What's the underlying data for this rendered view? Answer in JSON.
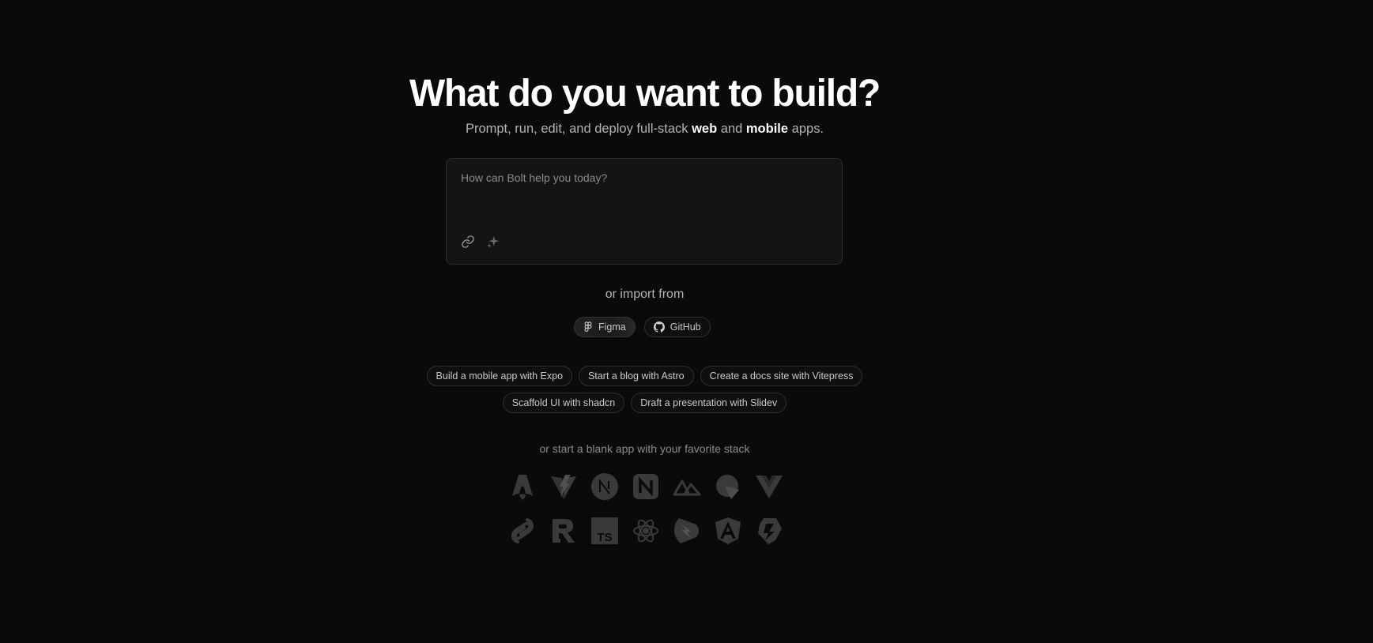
{
  "hero": {
    "title": "What do you want to build?",
    "subtitle_prefix": "Prompt, run, edit, and deploy full-stack ",
    "subtitle_web": "web",
    "subtitle_and": " and ",
    "subtitle_mobile": "mobile",
    "subtitle_suffix": " apps."
  },
  "prompt": {
    "placeholder": "How can Bolt help you today?",
    "tools": [
      "link-icon",
      "sparkle-icon"
    ]
  },
  "import": {
    "label": "or import from",
    "sources": [
      {
        "label": "Figma",
        "icon": "figma-icon",
        "active": true
      },
      {
        "label": "GitHub",
        "icon": "github-icon",
        "active": false
      }
    ]
  },
  "suggestions": {
    "row1": [
      "Build a mobile app with Expo",
      "Start a blog with Astro",
      "Create a docs site with Vitepress"
    ],
    "row2": [
      "Scaffold UI with shadcn",
      "Draft a presentation with Slidev"
    ]
  },
  "stacks": {
    "label": "or start a blank app with your favorite stack",
    "icons": [
      "astro-icon",
      "vite-icon",
      "nextjs-icon",
      "nativescript-icon",
      "nuxt-icon",
      "remix-icon",
      "vue-icon",
      "svelte-icon",
      "remotion-icon",
      "typescript-icon",
      "react-icon",
      "qwik-icon",
      "angular-icon",
      "solid-icon"
    ]
  },
  "colors": {
    "background": "#0a0a0a",
    "icon_gray": "#3a3a3a"
  }
}
